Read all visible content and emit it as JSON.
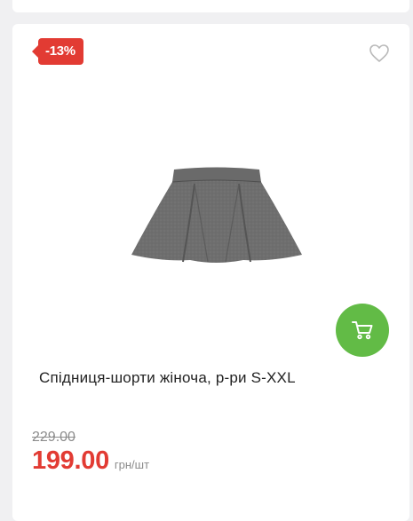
{
  "product": {
    "discount_badge": "-13%",
    "title": "Спідниця-шорти жіноча, р-ри S-XXL",
    "old_price": "229.00",
    "price": "199.00",
    "unit": "грн/шт"
  },
  "icons": {
    "favorite": "heart-outline-icon",
    "cart": "shopping-cart-icon"
  },
  "colors": {
    "badge": "#e23b33",
    "price": "#e23b33",
    "cart_button": "#62bb46",
    "old_price": "#8c8c8c"
  }
}
